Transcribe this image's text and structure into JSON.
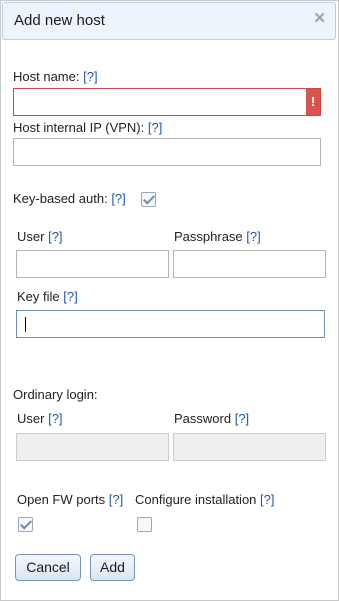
{
  "dialog": {
    "title": "Add new host"
  },
  "help_marker": "[?]",
  "host_name": {
    "label": "Host name:",
    "value": "",
    "error_icon": "!"
  },
  "host_internal_ip": {
    "label": "Host internal IP (VPN):",
    "value": ""
  },
  "key_based_auth": {
    "label": "Key-based auth:",
    "checked": true,
    "user_label": "User",
    "user_value": "",
    "passphrase_label": "Passphrase",
    "passphrase_value": "",
    "key_file_label": "Key file",
    "key_file_value": ""
  },
  "ordinary_login": {
    "heading": "Ordinary login:",
    "user_label": "User",
    "user_value": "",
    "password_label": "Password",
    "password_value": ""
  },
  "open_fw_ports": {
    "label": "Open FW ports",
    "checked": true
  },
  "configure_installation": {
    "label": "Configure installation",
    "checked": false
  },
  "buttons": {
    "cancel": "Cancel",
    "add": "Add"
  },
  "colors": {
    "accent": "#1f57a8",
    "error": "#d9534f",
    "title_bg": "#eef4fb"
  }
}
